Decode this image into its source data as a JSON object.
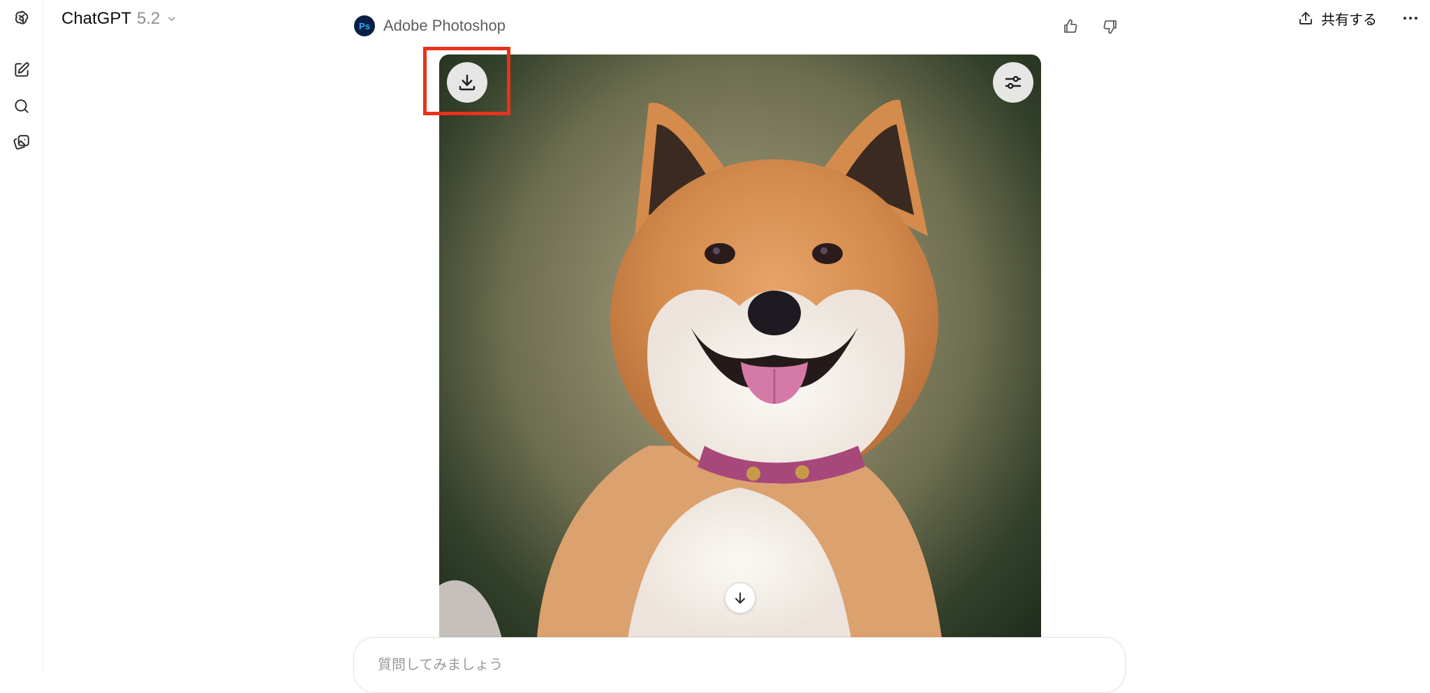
{
  "header": {
    "model_name": "ChatGPT",
    "model_version": "5.2",
    "share_label": "共有する"
  },
  "tool": {
    "badge": "Ps",
    "name": "Adobe Photoshop"
  },
  "composer": {
    "placeholder": "質問してみましょう"
  },
  "icons": {
    "sidebar": [
      "openai-logo-icon",
      "new-chat-icon",
      "search-icon",
      "images-icon"
    ],
    "header": [
      "chevron-down-icon",
      "share-icon",
      "more-icon"
    ],
    "message": [
      "thumbs-up-icon",
      "thumbs-down-icon"
    ],
    "image": [
      "download-icon",
      "adjust-sliders-icon",
      "scroll-down-arrow-icon"
    ]
  },
  "colors": {
    "highlight": "#e8321a",
    "photoshop_badge_bg": "#0a1f44",
    "photoshop_badge_fg": "#31a8ff"
  }
}
